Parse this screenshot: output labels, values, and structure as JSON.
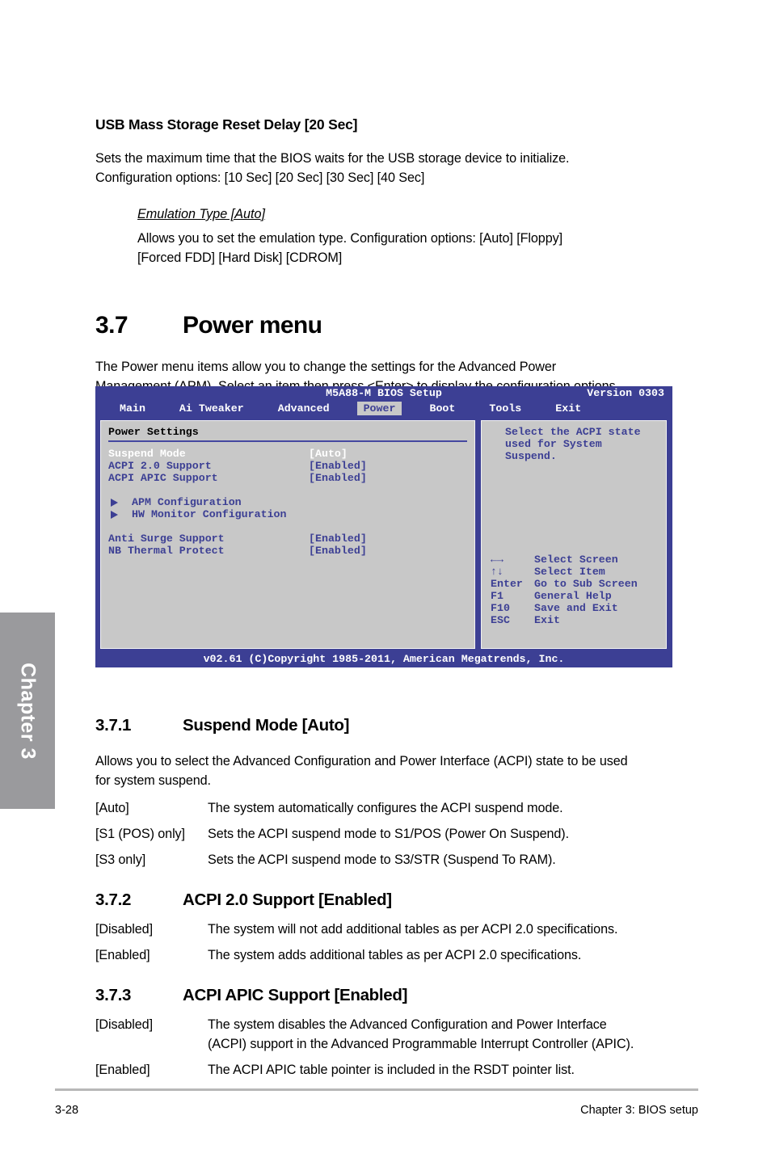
{
  "chapter_tab": {
    "label": "Chapter 3"
  },
  "top_section": {
    "heading": "USB Mass Storage Reset Delay [20 Sec]",
    "para_line1": "Sets the maximum time that the BIOS waits for the USB storage device to initialize.",
    "para_line2": "Configuration options: [10 Sec] [20 Sec] [30 Sec] [40 Sec]",
    "sub_heading": "Emulation Type [Auto]",
    "sub_line1": "Allows you to set the emulation type. Configuration options: [Auto] [Floppy]",
    "sub_line2": "[Forced FDD] [Hard Disk] [CDROM]"
  },
  "power_menu": {
    "number": "3.7",
    "title": "Power menu",
    "intro_line1": "The Power menu items allow you to change the settings for the Advanced Power",
    "intro_line2": "Management (APM). Select an item then press <Enter> to display the configuration options."
  },
  "bios": {
    "title": "M5A88-M BIOS Setup",
    "version": "Version 0303",
    "menu": [
      {
        "label": "Main",
        "active": false
      },
      {
        "label": "Ai Tweaker",
        "active": false
      },
      {
        "label": "Advanced",
        "active": false
      },
      {
        "label": "Power",
        "active": true
      },
      {
        "label": "Boot",
        "active": false
      },
      {
        "label": "Tools",
        "active": false
      },
      {
        "label": "Exit",
        "active": false
      }
    ],
    "panel_title": "Power Settings",
    "items": [
      {
        "label": "Suspend Mode",
        "value": "[Auto]",
        "selected": true
      },
      {
        "label": "ACPI 2.0 Support",
        "value": "[Enabled]",
        "selected": false
      },
      {
        "label": "ACPI APIC Support",
        "value": "[Enabled]",
        "selected": false
      }
    ],
    "submenus": [
      {
        "label": "APM Configuration"
      },
      {
        "label": "HW Monitor Configuration"
      }
    ],
    "items2": [
      {
        "label": "Anti Surge Support",
        "value": "[Enabled]",
        "selected": false
      },
      {
        "label": "NB Thermal Protect",
        "value": "[Enabled]",
        "selected": false
      }
    ],
    "help": {
      "line1": "Select the ACPI state",
      "line2": "used for System",
      "line3": "Suspend."
    },
    "keys": [
      {
        "key": "←→",
        "action": "Select Screen"
      },
      {
        "key": "↑↓",
        "action": "Select Item"
      },
      {
        "key": "Enter",
        "action": "Go to Sub Screen"
      },
      {
        "key": "F1",
        "action": "General Help"
      },
      {
        "key": "F10",
        "action": "Save and Exit"
      },
      {
        "key": "ESC",
        "action": "Exit"
      }
    ],
    "footer": "v02.61  (C)Copyright 1985-2011, American Megatrends, Inc.",
    "colors": {
      "chrome_blue": "#3c3f94",
      "panel_gray": "#c8c8c8",
      "selected_white": "#ffffff"
    }
  },
  "section_371": {
    "number": "3.7.1",
    "title": "Suspend Mode [Auto]",
    "intro_line1": "Allows you to select the Advanced Configuration and Power Interface (ACPI) state to be used",
    "intro_line2": "for system suspend.",
    "options": [
      {
        "term": "[Auto]",
        "desc": "The system automatically configures the ACPI suspend mode."
      },
      {
        "term": "[S1 (POS) only]",
        "desc": "Sets the ACPI suspend mode to S1/POS (Power On Suspend)."
      },
      {
        "term": "[S3 only]",
        "desc": "Sets the ACPI suspend mode to S3/STR (Suspend To RAM)."
      }
    ]
  },
  "section_372": {
    "number": "3.7.2",
    "title": "ACPI 2.0 Support [Enabled]",
    "options": [
      {
        "term": "[Disabled]",
        "desc": "The system will not add additional tables as per ACPI 2.0 specifications."
      },
      {
        "term": "[Enabled]",
        "desc": "The system adds additional tables as per ACPI 2.0 specifications."
      }
    ]
  },
  "section_373": {
    "number": "3.7.3",
    "title": "ACPI APIC Support [Enabled]",
    "options": [
      {
        "term": "[Disabled]",
        "desc_line1": "The system disables the Advanced Configuration and Power Interface",
        "desc_line2": "(ACPI) support in the Advanced Programmable Interrupt Controller (APIC)."
      },
      {
        "term": "[Enabled]",
        "desc_line1": "The ACPI APIC table pointer is included in the RSDT pointer list.",
        "desc_line2": ""
      }
    ]
  },
  "footer": {
    "page_number": "3-28",
    "chapter_label": "Chapter 3: BIOS setup"
  }
}
